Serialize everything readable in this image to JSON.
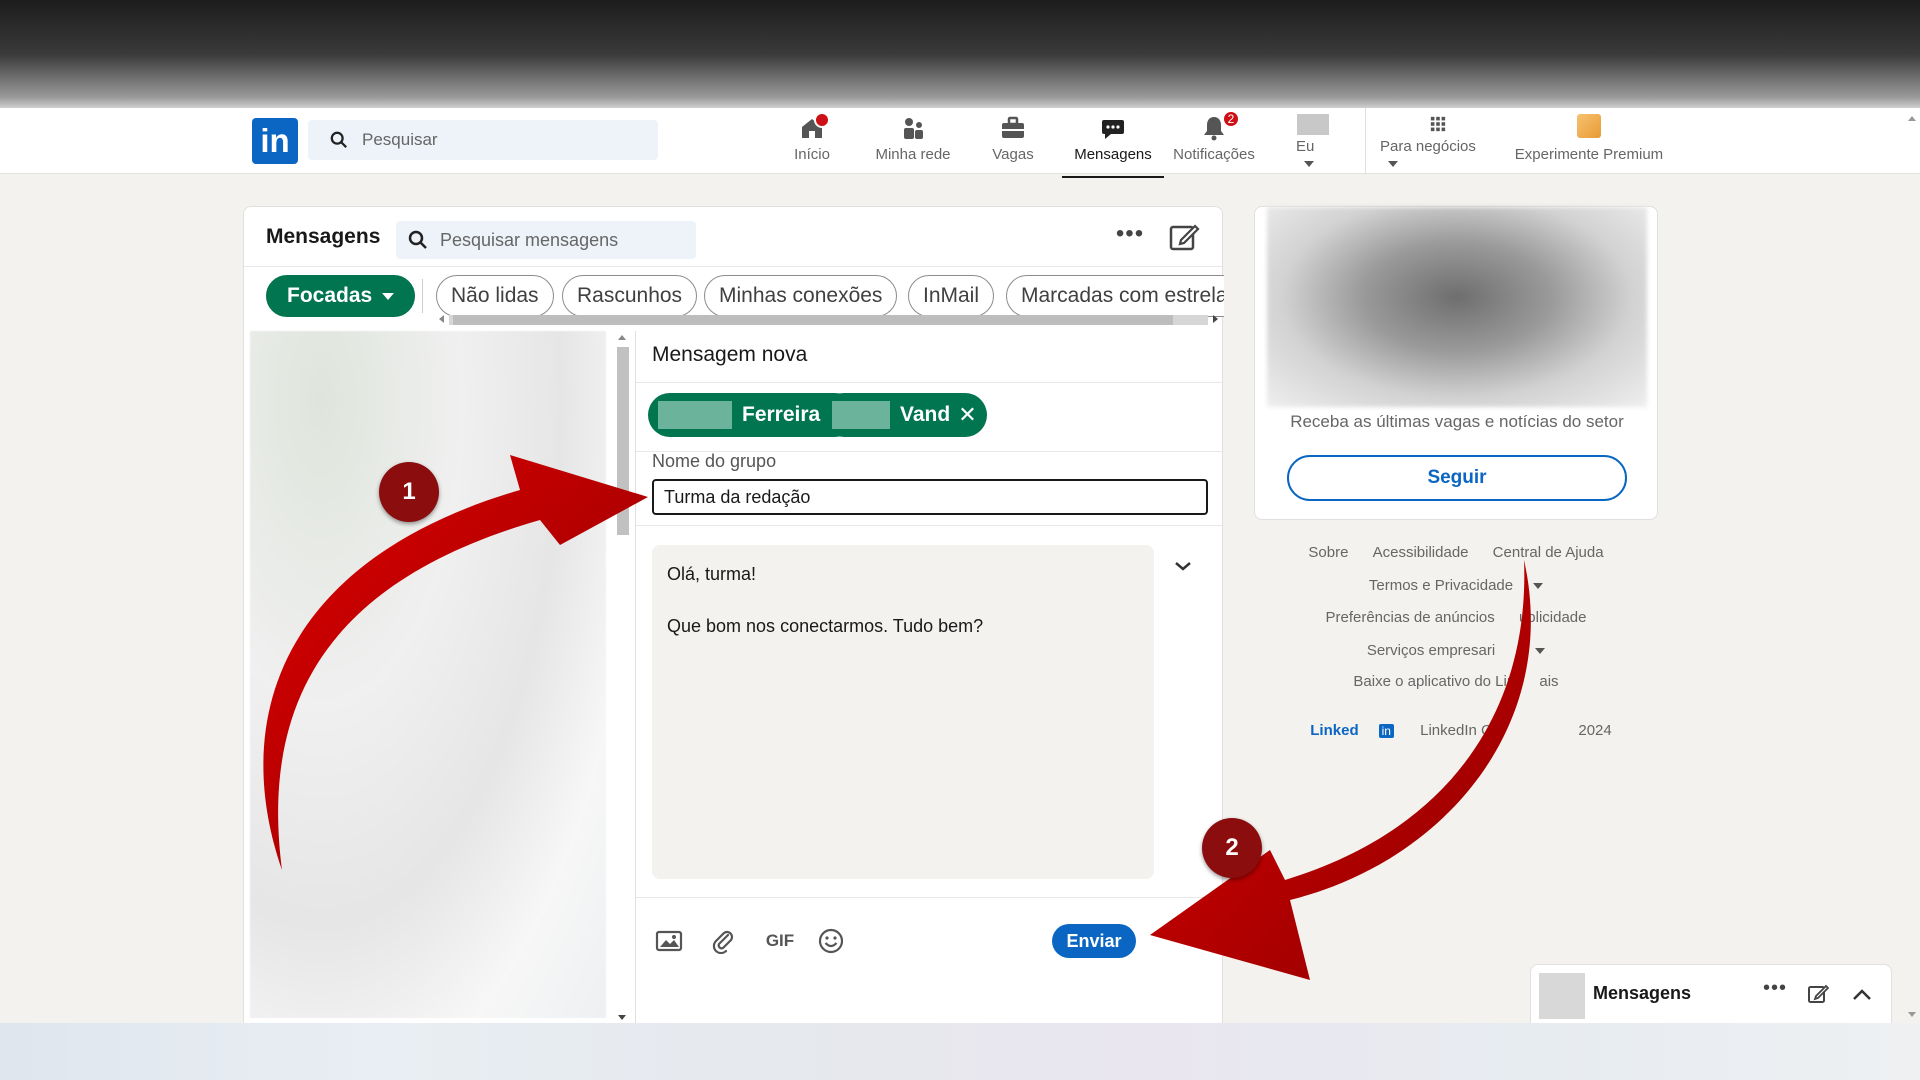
{
  "navbar": {
    "logo_text": "in",
    "search_placeholder": "Pesquisar",
    "items": [
      {
        "label": "Início",
        "icon": "home-icon"
      },
      {
        "label": "Minha rede",
        "icon": "network-icon"
      },
      {
        "label": "Vagas",
        "icon": "briefcase-icon"
      },
      {
        "label": "Mensagens",
        "icon": "messaging-icon",
        "active": true
      },
      {
        "label": "Notificações",
        "icon": "bell-icon",
        "badge": "2"
      },
      {
        "label": "Eu",
        "icon": "avatar"
      },
      {
        "label": "Para negócios",
        "icon": "grid-icon"
      },
      {
        "label": "Experimente Premium",
        "icon": "premium-icon"
      }
    ]
  },
  "messaging": {
    "title": "Mensagens",
    "search_placeholder": "Pesquisar mensagens",
    "more_label": "•••",
    "filters": {
      "active": "Focadas",
      "pills": [
        "Não lidas",
        "Rascunhos",
        "Minhas conexões",
        "InMail",
        "Marcadas com estrela"
      ]
    },
    "new_message": {
      "title": "Mensagem nova",
      "recipients": [
        {
          "name": "Ferreira"
        },
        {
          "name": "Vand"
        }
      ],
      "remove_glyph": "✕",
      "add_glyph": "+",
      "group_name_label": "Nome do grupo",
      "group_name_value": "Turma da redação",
      "body_lines": [
        "Olá, turma!",
        "Que bom nos conectarmos. Tudo bem?"
      ],
      "gif_label": "GIF",
      "send_label": "Enviar"
    }
  },
  "right_rail": {
    "ad_text": "Receba as últimas vagas e notícias do setor",
    "follow_label": "Seguir",
    "footer_links": {
      "row1": [
        "Sobre",
        "Acessibilidade",
        "Central de Ajuda"
      ],
      "row2": "Termos e Privacidade",
      "row3": [
        "Preferências de anúncios",
        "ublicidade"
      ],
      "row4": "Serviços empresari",
      "row5": [
        "Baixe o aplicativo do Lin",
        "ais"
      ],
      "brand_linked": "Linked",
      "brand_in": "in",
      "copyright_prefix": "LinkedIn Co",
      "copyright_year": "2024"
    }
  },
  "dock": {
    "label": "Mensagens",
    "more_label": "•••"
  },
  "annotations": {
    "step1": "1",
    "step2": "2",
    "arrow_color": "#d50000"
  }
}
